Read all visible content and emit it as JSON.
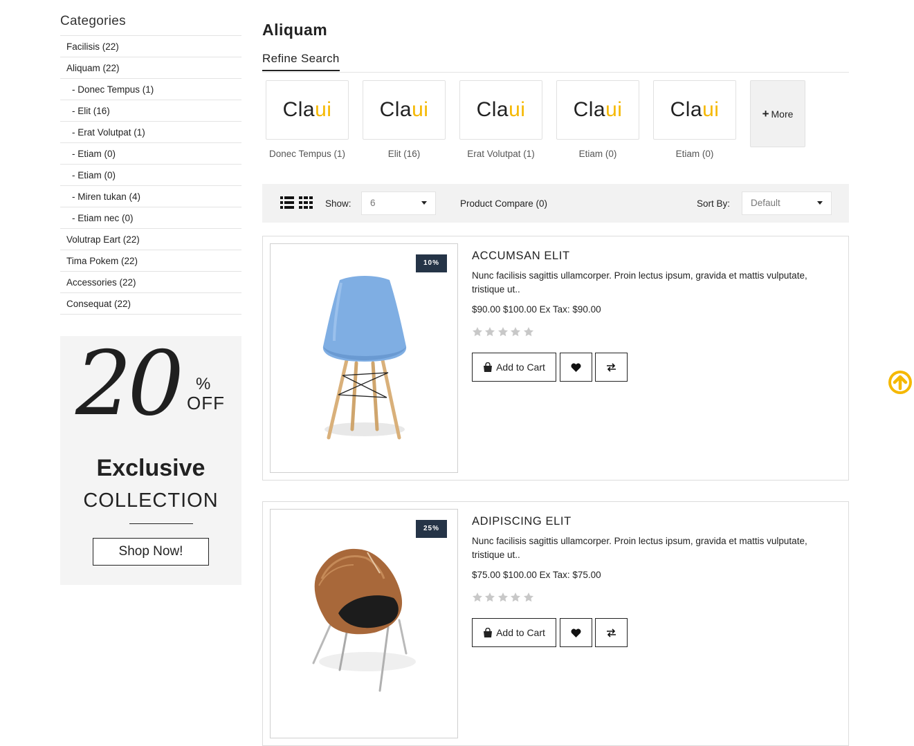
{
  "sidebar": {
    "heading": "Categories",
    "categories": [
      {
        "label": "Facilisis (22)"
      },
      {
        "label": "Aliquam (22)"
      },
      {
        "label": "- Donec Tempus (1)"
      },
      {
        "label": "- Elit (16)"
      },
      {
        "label": "- Erat Volutpat (1)"
      },
      {
        "label": "- Etiam (0)"
      },
      {
        "label": "- Etiam (0)"
      },
      {
        "label": "- Miren tukan (4)"
      },
      {
        "label": "- Etiam nec (0)"
      },
      {
        "label": "Volutrap Eart (22)"
      },
      {
        "label": "Tima Pokem (22)"
      },
      {
        "label": "Accessories (22)"
      },
      {
        "label": "Consequat (22)"
      }
    ],
    "promo": {
      "number": "20",
      "percent": "%",
      "off": "OFF",
      "title": "Exclusive",
      "subtitle": "COLLECTION",
      "button": "Shop Now!"
    }
  },
  "main": {
    "title": "Aliquam",
    "refine_label": "Refine Search",
    "logo_text": {
      "main": "Cla",
      "accent": "ui"
    },
    "subcategories": [
      {
        "name": "Donec Tempus (1)"
      },
      {
        "name": "Elit (16)"
      },
      {
        "name": "Erat Volutpat (1)"
      },
      {
        "name": "Etiam (0)"
      },
      {
        "name": "Etiam (0)"
      }
    ],
    "more_label": "More",
    "toolbar": {
      "show_label": "Show:",
      "show_value": "6",
      "compare": "Product Compare (0)",
      "sort_label": "Sort By:",
      "sort_value": "Default"
    },
    "products": [
      {
        "name": "ACCUMSAN ELIT",
        "badge": "10%",
        "description": "Nunc facilisis sagittis ullamcorper. Proin lectus ipsum, gravida et mattis vulputate, tristique ut..",
        "price": "$90.00 $100.00 Ex Tax: $90.00",
        "rating": 0,
        "cart_label": "Add to Cart"
      },
      {
        "name": "ADIPISCING ELIT",
        "badge": "25%",
        "description": "Nunc facilisis sagittis ullamcorper. Proin lectus ipsum, gravida et mattis vulputate, tristique ut..",
        "price": "$75.00 $100.00 Ex Tax: $75.00",
        "rating": 0,
        "cart_label": "Add to Cart"
      }
    ]
  },
  "colors": {
    "accent": "#f5b800",
    "badge_bg": "#253447",
    "toolbar_bg": "#f2f2f2",
    "promo_bg": "#f4f4f4",
    "star_empty": "#c8c8c8"
  },
  "icons": {
    "list_view": "list-view-icon",
    "grid_view": "grid-view-icon",
    "cart": "shopping-bag-icon",
    "wishlist": "heart-icon",
    "compare": "exchange-icon",
    "scroll_top": "arrow-up-circle-icon",
    "more": "plus-icon"
  }
}
